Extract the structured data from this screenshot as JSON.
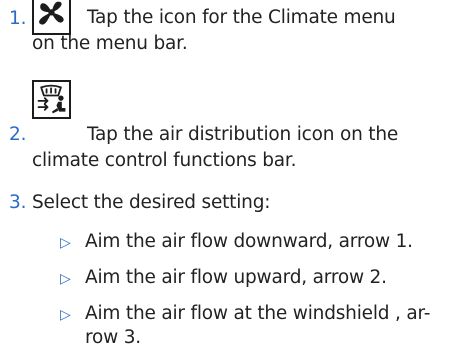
{
  "steps": [
    {
      "number": "1.",
      "icon": "fan-icon",
      "line1": "Tap the icon for the Climate menu",
      "line2": "on the menu bar."
    },
    {
      "number": "2.",
      "icon": "air-distribution-icon",
      "line1": "Tap the air distribution icon on the",
      "line2": "climate control functions bar."
    },
    {
      "number": "3.",
      "line1": "Select the desired setting:"
    }
  ],
  "options": [
    {
      "line1": "Aim the air flow downward, arrow 1."
    },
    {
      "line1": "Aim the air flow upward, arrow 2."
    },
    {
      "line1": "Aim the air flow at the windshield , ar-",
      "line2": "row 3."
    }
  ],
  "colors": {
    "accent": "#2b6bc7",
    "text": "#222222"
  }
}
